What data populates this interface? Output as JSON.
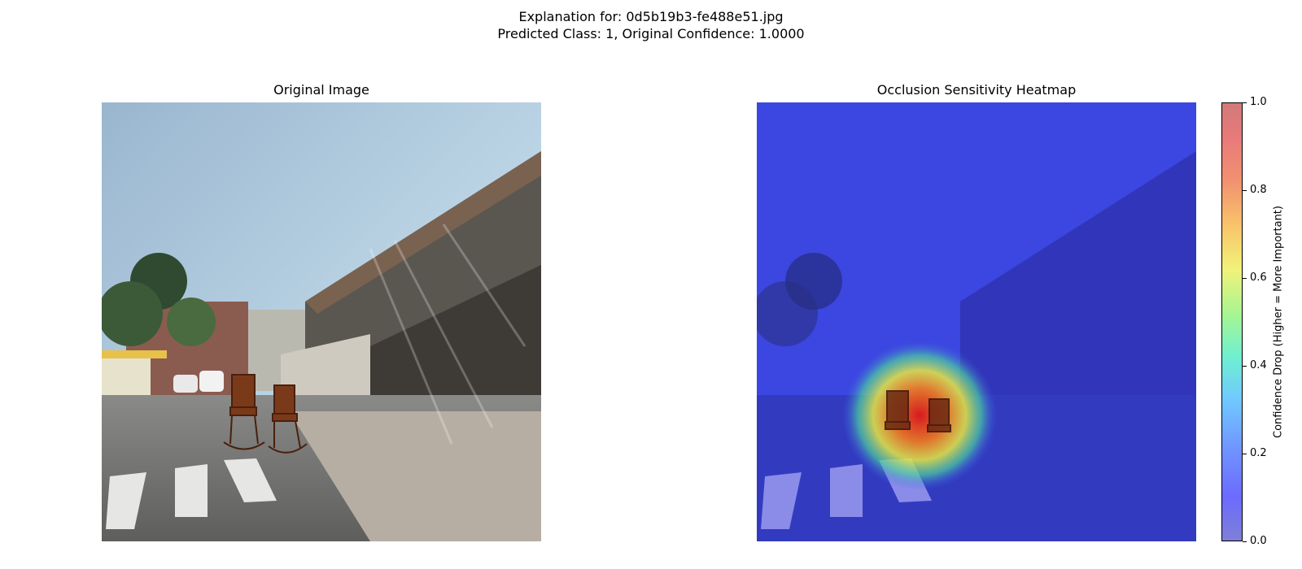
{
  "figure": {
    "title_line1": "Explanation for: 0d5b19b3-fe488e51.jpg",
    "title_line2": "Predicted Class: 1, Original Confidence: 1.0000"
  },
  "panels": {
    "left_title": "Original Image",
    "right_title": "Occlusion Sensitivity Heatmap"
  },
  "chart_data": {
    "type": "heatmap",
    "title": "Occlusion Sensitivity Heatmap",
    "colorbar": {
      "label": "Confidence Drop (Higher = More Important)",
      "range": [
        0,
        1
      ],
      "ticks": [
        "0.0",
        "0.2",
        "0.4",
        "0.6",
        "0.8",
        "1.0"
      ],
      "colormap": "jet"
    },
    "hotspot": {
      "description_visible": false,
      "peak_value": 1.0
    },
    "grid": false
  },
  "colors": {
    "overlay_low": "#3a3ae8",
    "overlay_high": "#e03020"
  }
}
